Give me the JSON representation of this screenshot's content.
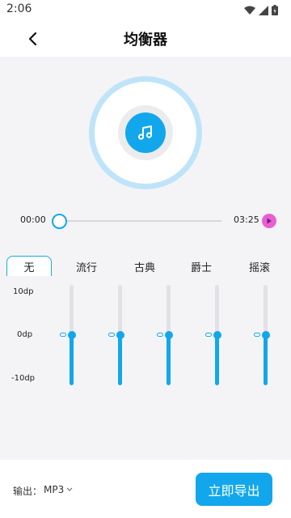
{
  "status": {
    "time": "2:06"
  },
  "header": {
    "title": "均衡器"
  },
  "player": {
    "time_start": "00:00",
    "time_end": "03:25",
    "progress": 0.0
  },
  "tabs": [
    {
      "label": "无",
      "active": true
    },
    {
      "label": "流行",
      "active": false
    },
    {
      "label": "古典",
      "active": false
    },
    {
      "label": "爵士",
      "active": false
    },
    {
      "label": "摇滚",
      "active": false
    }
  ],
  "eq": {
    "scale": {
      "top": "10dp",
      "mid": "0dp",
      "bottom": "-10dp"
    },
    "bands": [
      {
        "level_db": 0
      },
      {
        "level_db": 0
      },
      {
        "level_db": 0
      },
      {
        "level_db": 0
      },
      {
        "level_db": 0
      }
    ]
  },
  "footer": {
    "output_label": "输出：",
    "output_value": "MP3",
    "export_label": "立即导出"
  },
  "colors": {
    "accent": "#12a7ec",
    "play": "#e85fd4",
    "disc_ring": "#bfe4fa"
  }
}
